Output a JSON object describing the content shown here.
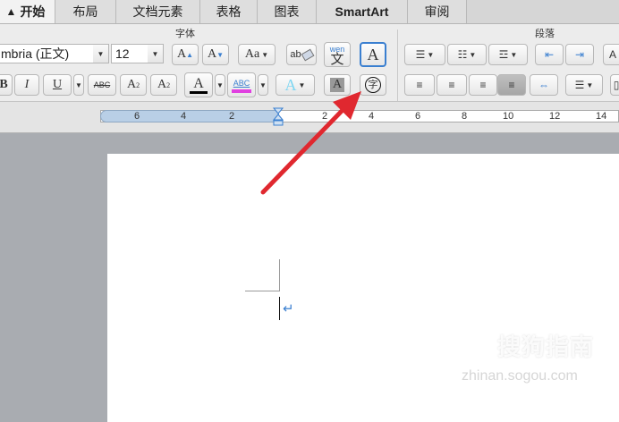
{
  "tabs": [
    {
      "label": "开始",
      "icon": "home-icon",
      "active": true
    },
    {
      "label": "布局"
    },
    {
      "label": "文档元素"
    },
    {
      "label": "表格"
    },
    {
      "label": "图表"
    },
    {
      "label": "SmartArt"
    },
    {
      "label": "审阅"
    }
  ],
  "ribbon": {
    "font_group_label": "字体",
    "paragraph_group_label": "段落",
    "font_name": "mbria (正文)",
    "font_size": "12",
    "buttons": {
      "grow": "A",
      "shrink": "A",
      "change_case": "Aa",
      "clear_format": "ab",
      "phonetic_top": "wen",
      "phonetic_bottom": "文",
      "char_border": "A",
      "bold": "B",
      "italic": "I",
      "underline": "U",
      "strike": "ABC",
      "superscript": "A",
      "subscript": "A",
      "font_color": "A",
      "highlight": "ABC",
      "text_effect": "A",
      "char_shading": "A",
      "enclose_char": "字"
    }
  },
  "ruler": {
    "labels": [
      "6",
      "4",
      "2",
      "2",
      "4",
      "6",
      "8",
      "10",
      "12",
      "14"
    ]
  },
  "document": {
    "paragraph_mark": "↵"
  },
  "watermark": {
    "brand": "搜狗指南",
    "url": "zhinan.sogou.com"
  },
  "colors": {
    "accent": "#3a7fd0",
    "arrow": "#e0282f",
    "font_color_bar": "#000000",
    "highlight_bar": "#e040e0"
  }
}
